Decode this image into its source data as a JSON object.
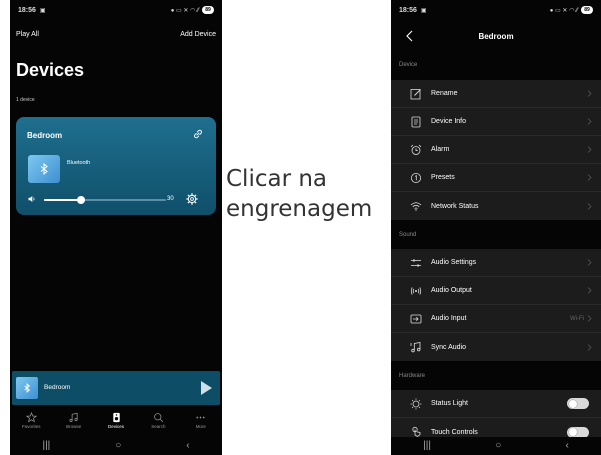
{
  "left_phone": {
    "status": {
      "time": "18:56",
      "battery": "89"
    },
    "top": {
      "play_all": "Play All",
      "add_device": "Add Device"
    },
    "title": "Devices",
    "device_count": "1 device",
    "card": {
      "name": "Bedroom",
      "source": "Bluetooth",
      "volume": 30,
      "volume_max": 100
    },
    "mini_player": {
      "name": "Bedroom"
    },
    "nav": [
      {
        "label": "Favorites",
        "icon": "star-icon"
      },
      {
        "label": "Browse",
        "icon": "music-note-icon"
      },
      {
        "label": "Devices",
        "icon": "speaker-icon"
      },
      {
        "label": "Search",
        "icon": "search-icon"
      },
      {
        "label": "More",
        "icon": "more-dots-icon"
      }
    ]
  },
  "caption": "Clicar na engrenagem",
  "right_phone": {
    "status": {
      "time": "18:56",
      "battery": "89"
    },
    "title": "Bedroom",
    "sections": {
      "device": {
        "label": "Device",
        "items": [
          {
            "label": "Rename",
            "icon": "edit-icon"
          },
          {
            "label": "Device Info",
            "icon": "document-icon"
          },
          {
            "label": "Alarm",
            "icon": "alarm-clock-icon"
          },
          {
            "label": "Presets",
            "icon": "preset-number-icon"
          },
          {
            "label": "Network Status",
            "icon": "wifi-icon"
          }
        ]
      },
      "sound": {
        "label": "Sound",
        "items": [
          {
            "label": "Audio Settings",
            "icon": "equalizer-icon"
          },
          {
            "label": "Audio Output",
            "icon": "broadcast-icon"
          },
          {
            "label": "Audio Input",
            "icon": "input-icon",
            "value": "Wi-Fi"
          },
          {
            "label": "Sync Audio",
            "icon": "music-sync-icon"
          }
        ]
      },
      "hardware": {
        "label": "Hardware",
        "items": [
          {
            "label": "Status Light",
            "icon": "light-icon",
            "toggle": false
          },
          {
            "label": "Touch Controls",
            "icon": "touch-icon",
            "toggle": false
          }
        ]
      }
    }
  },
  "colors": {
    "card": "#1f6f8f",
    "mini_player": "#0e4d66",
    "list_bg": "#1c1c1c",
    "bg": "#050505"
  }
}
